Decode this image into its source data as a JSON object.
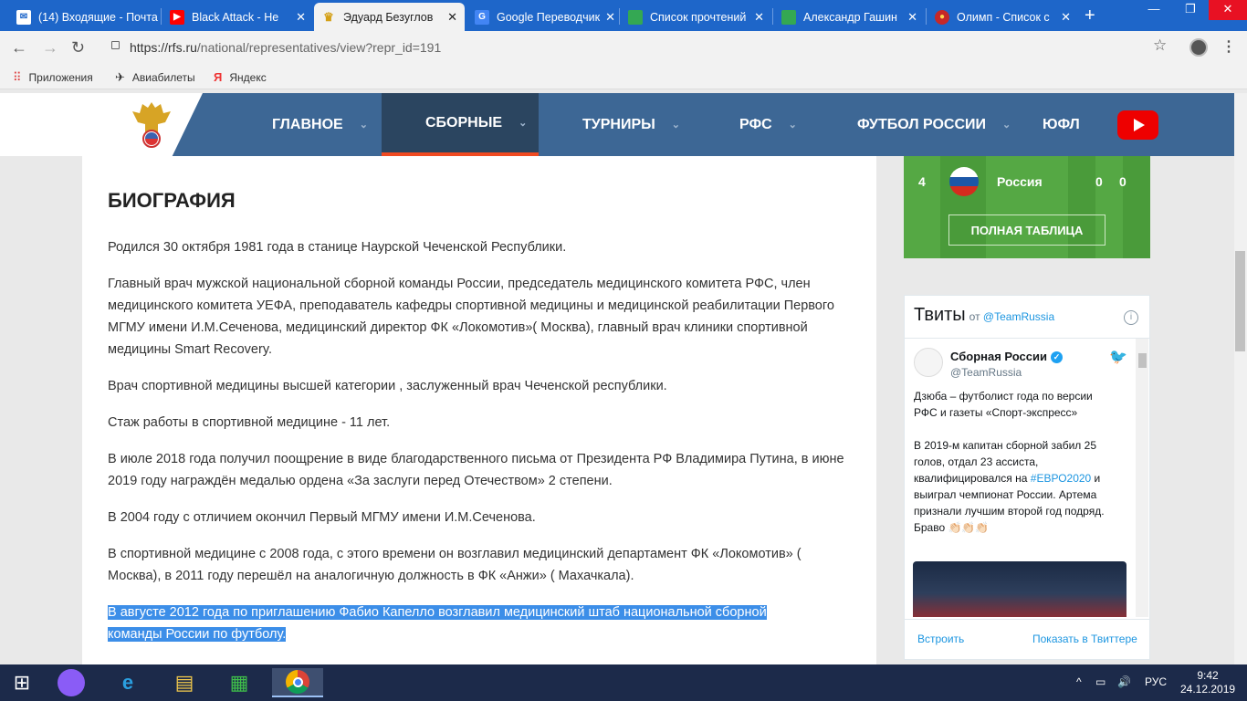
{
  "browser": {
    "tabs": [
      {
        "label": "(14) Входящие - Почта",
        "icon": "mail-icon",
        "color": "#1e66c9",
        "active": false
      },
      {
        "label": "Black Attack - Не",
        "icon": "youtube-icon",
        "color": "#ff0000",
        "active": false
      },
      {
        "label": "Эдуард Безуглов",
        "icon": "rfs-emblem-icon",
        "color": "#d4a017",
        "active": true
      },
      {
        "label": "Google Переводчик",
        "icon": "google-translate-icon",
        "color": "#4285f4",
        "active": false
      },
      {
        "label": "Список прочтений",
        "icon": "sheet-icon",
        "color": "#34a853",
        "active": false
      },
      {
        "label": "Александр Гашин",
        "icon": "sheet-icon",
        "color": "#34a853",
        "active": false
      },
      {
        "label": "Олимп - Список с",
        "icon": "olimp-icon",
        "color": "#c62828",
        "active": false
      }
    ],
    "new_tab": "+",
    "url_host": "https://rfs.ru",
    "url_path": "/national/representatives/view?repr_id=191",
    "bookmarks": [
      {
        "label": "Приложения",
        "icon": "apps-grid-icon"
      },
      {
        "label": "Авиабилеты",
        "icon": "plane-icon"
      },
      {
        "label": "Яндекс",
        "icon": "yandex-icon"
      }
    ]
  },
  "site": {
    "nav": [
      {
        "label": "ГЛАВНОЕ",
        "active": false
      },
      {
        "label": "СБОРНЫЕ",
        "active": true
      },
      {
        "label": "ТУРНИРЫ",
        "active": false
      },
      {
        "label": "РФС",
        "active": false
      },
      {
        "label": "ФУТБОЛ РОССИИ",
        "active": false
      },
      {
        "label": "ЮФЛ",
        "active": false
      }
    ],
    "accent": "#f04a21",
    "nav_bg": "#3d6795"
  },
  "article": {
    "title": "БИОГРАФИЯ",
    "paragraphs": [
      "Родился 30 октября 1981 года в станице Наурской Чеченской Республики.",
      "Главный врач мужской национальной сборной команды России, председатель медицинского комитета РФС,  член медицинского комитета УЕФА, преподаватель кафедры спортивной медицины и медицинской реабилитации Первого МГМУ имени И.М.Сеченова, медицинский директор ФК «Локомотив»( Москва), главный врач клиники спортивной медицины Smart Recovery.",
      "Врач спортивной медицины высшей категории , заслуженный врач Чеченской республики.",
      "Стаж работы в спортивной медицине - 11 лет.",
      "В июле 2018 года получил поощрение в виде благодарственного письма от Президента РФ Владимира Путина, в июне 2019 году награждён медалью ордена «За заслуги перед Отечеством» 2 степени.",
      "В 2004 году с отличием окончил Первый МГМУ имени И.М.Сеченова.",
      "В спортивной медицине с 2008 года, с этого времени он возглавил медицинский департамент ФК «Локомотив» ( Москва), в 2011 году перешёл на аналогичную должность в ФК «Анжи» ( Махачкала)."
    ],
    "highlighted": "В августе 2012 года по приглашению Фабио Капелло возглавил медицинский штаб национальной сборной команды России по футболу."
  },
  "standings": {
    "row": {
      "position": "4",
      "team": "Россия",
      "col1": "0",
      "col2": "0"
    },
    "full_table_button": "ПОЛНАЯ ТАБЛИЦА"
  },
  "tweets": {
    "title": "Твиты",
    "from": "от",
    "handle_link": "@TeamRussia",
    "author": "Сборная России",
    "author_handle": "@TeamRussia",
    "text_1": "Дзюба – футболист года по версии РФС и газеты «Спорт-экспресс»",
    "text_2a": "В 2019-м капитан сборной забил 25 голов, отдал 23 ассиста, квалифицировался на ",
    "hashtag": "#ЕВРО2020",
    "text_2b": " и выиграл чемпионат России. Артема признали лучшим второй год подряд. Браво 👏🏻👏🏻👏🏻",
    "embed": "Встроить",
    "view_on_twitter": "Показать в Твиттере"
  },
  "taskbar": {
    "lang": "РУС",
    "time": "9:42",
    "date": "24.12.2019"
  }
}
